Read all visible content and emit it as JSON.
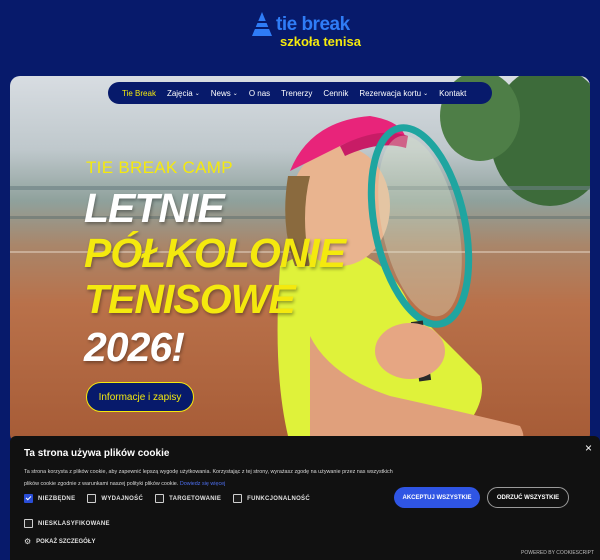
{
  "logo": {
    "title": "tie break",
    "subtitle": "szkoła tenisa"
  },
  "nav": {
    "items": [
      {
        "label": "Tie Break",
        "dropdown": false,
        "active": true
      },
      {
        "label": "Zajęcia",
        "dropdown": true,
        "active": false
      },
      {
        "label": "News",
        "dropdown": true,
        "active": false
      },
      {
        "label": "O nas",
        "dropdown": false,
        "active": false
      },
      {
        "label": "Trenerzy",
        "dropdown": false,
        "active": false
      },
      {
        "label": "Cennik",
        "dropdown": false,
        "active": false
      },
      {
        "label": "Rezerwacja kortu",
        "dropdown": true,
        "active": false
      },
      {
        "label": "Kontakt",
        "dropdown": false,
        "active": false
      }
    ],
    "chevron": "⌄"
  },
  "hero": {
    "eyebrow": "TIE BREAK CAMP",
    "line1": "LETNIE",
    "line2": "PÓŁKOLONIE",
    "line3": "TENISOWE",
    "line4": "2026!",
    "cta": "Informacje i zapisy"
  },
  "cookie": {
    "title": "Ta strona używa plików cookie",
    "close": "×",
    "text": "Ta strona korzysta z plików cookie, aby zapewnić lepszą wygodę użytkowania. Korzystając z tej strony, wyrażasz zgodę na używanie przez nas wszystkich plików cookie zgodnie z warunkami naszej polityki plików cookie.",
    "link": "Dowiedz się więcej",
    "checkboxes": [
      {
        "label": "NIEZBĘDNE",
        "checked": true
      },
      {
        "label": "WYDAJNOŚĆ",
        "checked": false
      },
      {
        "label": "TARGETOWANIE",
        "checked": false
      },
      {
        "label": "FUNKCJONALNOŚĆ",
        "checked": false
      },
      {
        "label": "NIESKLASYFIKOWANE",
        "checked": false
      }
    ],
    "details": "POKAŻ SZCZEGÓŁY",
    "accept": "AKCEPTUJ WSZYSTKIE",
    "reject": "ODRZUĆ WSZYSTKIE",
    "powered": "POWERED BY COOKIESCRIPT"
  },
  "colors": {
    "navy": "#071a6b",
    "yellow": "#f4e90e",
    "blue": "#2f7cf6",
    "accept": "#2f55e4"
  }
}
